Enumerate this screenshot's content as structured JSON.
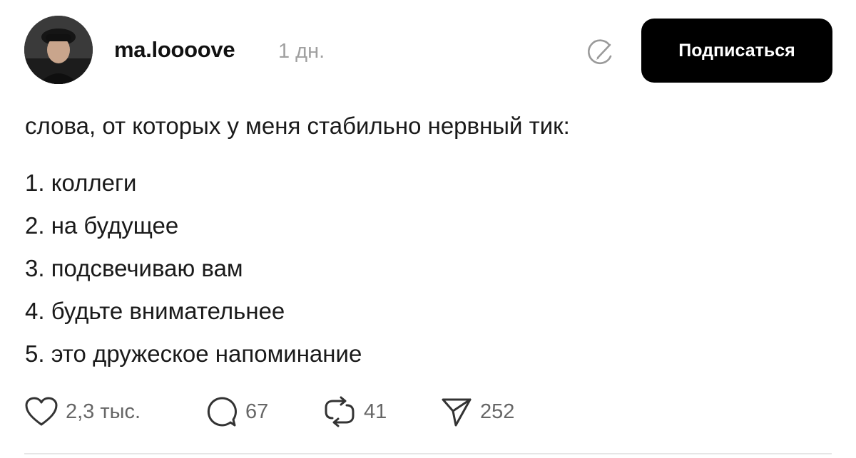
{
  "post": {
    "username": "ma.loooove",
    "time": "1 дн.",
    "subscribe_label": "Подписаться",
    "intro": "слова, от которых у меня стабильно нервный тик:",
    "list": [
      "1. коллеги",
      "2. на будущее",
      "3. подсвечиваю вам",
      "4. будьте внимательнее",
      "5. это дружеское напоминание"
    ],
    "actions": {
      "likes": "2,3 тыс.",
      "comments": "67",
      "reposts": "41",
      "shares": "252"
    }
  },
  "icons": {
    "verify": "pencil-circle-icon",
    "like": "heart-icon",
    "comment": "comment-bubble-icon",
    "repost": "repost-arrows-icon",
    "share": "paper-plane-icon"
  },
  "colors": {
    "button_bg": "#000000",
    "button_text": "#ffffff",
    "secondary_text": "#a0a0a0",
    "icon_gray": "#666666"
  }
}
